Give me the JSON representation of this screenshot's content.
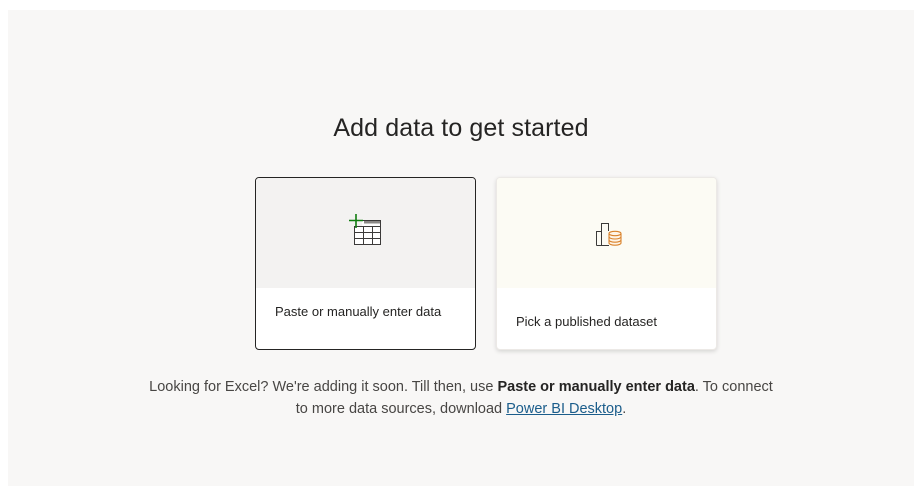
{
  "heading": "Add data to get started",
  "cards": [
    {
      "label": "Paste or manually enter data",
      "icon": "table-add-icon",
      "selected": true
    },
    {
      "label": "Pick a published dataset",
      "icon": "dataset-icon",
      "selected": false
    }
  ],
  "footer": {
    "text_before": "Looking for Excel? We're adding it soon. Till then, use ",
    "bold_text": "Paste or manually enter data",
    "text_middle": ". To connect",
    "text_line2": "to more data sources, download ",
    "link_text": "Power BI Desktop",
    "text_after": "."
  },
  "colors": {
    "accent_green": "#107c10",
    "accent_orange": "#d9822b",
    "link": "#1b5d8b",
    "text": "#252423"
  }
}
